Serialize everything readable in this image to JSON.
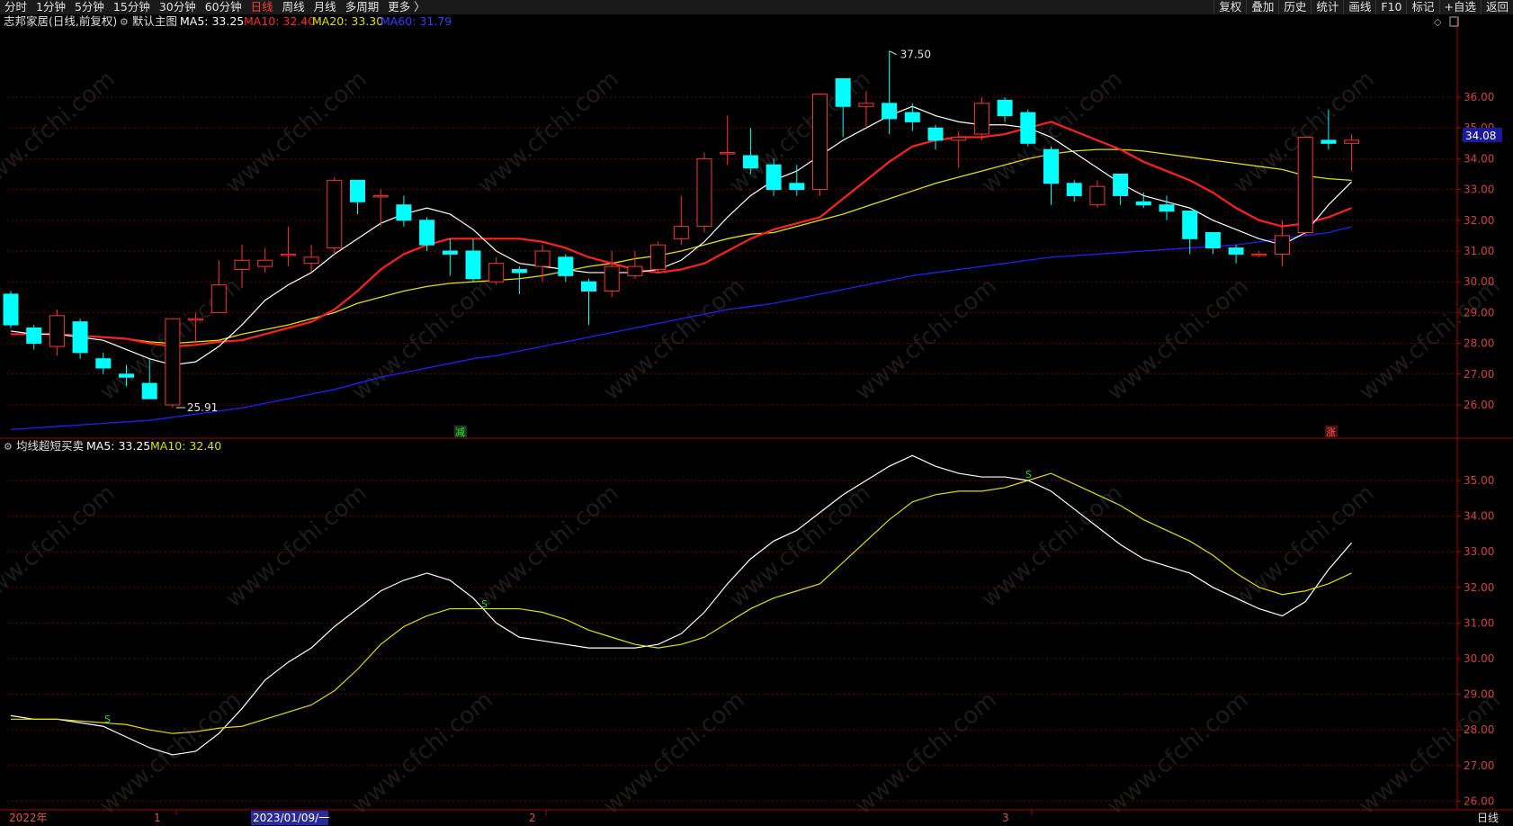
{
  "topbar": {
    "periods": [
      "分时",
      "1分钟",
      "5分钟",
      "15分钟",
      "30分钟",
      "60分钟",
      "日线",
      "周线",
      "月线",
      "多周期",
      "更多 〉"
    ],
    "active_period": "日线",
    "right_buttons": [
      "复权",
      "叠加",
      "历史",
      "统计",
      "画线",
      "F10",
      "标记",
      "+自选",
      "返回"
    ]
  },
  "main_header": {
    "stock": "志邦家居(日线,前复权)",
    "template": "默认主图",
    "ma5": "MA5: 33.25",
    "ma10": "MA10: 32.40",
    "ma20": "MA20: 33.30",
    "ma60": "MA60: 31.79"
  },
  "sub_header": {
    "name": "均线超短买卖",
    "ma5": "MA5: 33.25",
    "ma10": "MA10: 32.40"
  },
  "labels": {
    "high": "37.50",
    "low": "25.91",
    "current_price": "34.08",
    "sig_down": "减",
    "sig_up": "涨",
    "sub_signal": "S",
    "period_corner": "日线",
    "watermark": "www.cfchi.com"
  },
  "x_axis": {
    "labels": [
      "2022年",
      "1",
      "2023/01/09/一",
      "2",
      "3"
    ],
    "highlight": "2023/01/09/一"
  },
  "colors": {
    "up": "#ff3232",
    "down": "#00ffff",
    "ma5": "#ffffff",
    "ma10": "#ff2020",
    "ma20": "#e0e000",
    "ma60": "#2020ff",
    "grid": "#7a0000",
    "axis": "#b00000"
  },
  "chart_data": [
    {
      "type": "candlestick",
      "title": "志邦家居(日线,前复权)",
      "y_ticks": [
        26,
        27,
        28,
        29,
        30,
        31,
        32,
        33,
        34,
        35,
        36
      ],
      "candles": [
        {
          "o": 29.6,
          "c": 28.6,
          "h": 29.7,
          "l": 28.5
        },
        {
          "o": 28.5,
          "c": 28.0,
          "h": 28.6,
          "l": 27.8
        },
        {
          "o": 27.9,
          "c": 28.9,
          "h": 29.1,
          "l": 27.6
        },
        {
          "o": 28.7,
          "c": 27.7,
          "h": 28.8,
          "l": 27.5
        },
        {
          "o": 27.5,
          "c": 27.2,
          "h": 27.7,
          "l": 27.0
        },
        {
          "o": 27.0,
          "c": 26.9,
          "h": 27.3,
          "l": 26.6
        },
        {
          "o": 26.7,
          "c": 26.2,
          "h": 27.5,
          "l": 26.2
        },
        {
          "o": 26.0,
          "c": 28.8,
          "h": 28.8,
          "l": 25.91
        },
        {
          "o": 28.8,
          "c": 28.8,
          "h": 29.0,
          "l": 28.0
        },
        {
          "o": 29.0,
          "c": 29.9,
          "h": 30.7,
          "l": 29.0
        },
        {
          "o": 30.4,
          "c": 30.7,
          "h": 31.2,
          "l": 29.8
        },
        {
          "o": 30.5,
          "c": 30.7,
          "h": 31.1,
          "l": 30.3
        },
        {
          "o": 30.9,
          "c": 30.9,
          "h": 31.8,
          "l": 30.5
        },
        {
          "o": 30.6,
          "c": 30.8,
          "h": 31.2,
          "l": 30.3
        },
        {
          "o": 31.1,
          "c": 33.3,
          "h": 33.4,
          "l": 30.9
        },
        {
          "o": 33.3,
          "c": 32.6,
          "h": 33.3,
          "l": 32.2
        },
        {
          "o": 32.8,
          "c": 32.8,
          "h": 33.0,
          "l": 31.8
        },
        {
          "o": 32.5,
          "c": 32.0,
          "h": 32.8,
          "l": 31.8
        },
        {
          "o": 32.0,
          "c": 31.2,
          "h": 32.1,
          "l": 31.0
        },
        {
          "o": 31.0,
          "c": 30.9,
          "h": 31.4,
          "l": 30.2
        },
        {
          "o": 31.0,
          "c": 30.1,
          "h": 31.4,
          "l": 30.0
        },
        {
          "o": 30.0,
          "c": 30.6,
          "h": 30.8,
          "l": 29.9
        },
        {
          "o": 30.4,
          "c": 30.3,
          "h": 30.5,
          "l": 29.6
        },
        {
          "o": 30.5,
          "c": 31.0,
          "h": 31.2,
          "l": 30.0
        },
        {
          "o": 30.8,
          "c": 30.2,
          "h": 30.9,
          "l": 30.0
        },
        {
          "o": 30.0,
          "c": 29.7,
          "h": 30.1,
          "l": 28.6
        },
        {
          "o": 29.7,
          "c": 30.5,
          "h": 31.0,
          "l": 29.5
        },
        {
          "o": 30.2,
          "c": 30.5,
          "h": 31.0,
          "l": 30.1
        },
        {
          "o": 30.4,
          "c": 31.2,
          "h": 31.3,
          "l": 30.3
        },
        {
          "o": 31.4,
          "c": 31.8,
          "h": 32.8,
          "l": 31.2
        },
        {
          "o": 31.8,
          "c": 34.0,
          "h": 34.2,
          "l": 31.6
        },
        {
          "o": 34.2,
          "c": 34.2,
          "h": 35.4,
          "l": 33.8
        },
        {
          "o": 34.1,
          "c": 33.7,
          "h": 35.0,
          "l": 33.5
        },
        {
          "o": 33.8,
          "c": 33.0,
          "h": 34.0,
          "l": 32.8
        },
        {
          "o": 33.2,
          "c": 33.0,
          "h": 33.8,
          "l": 32.8
        },
        {
          "o": 33.0,
          "c": 36.1,
          "h": 36.1,
          "l": 32.8
        },
        {
          "o": 36.6,
          "c": 35.7,
          "h": 36.6,
          "l": 34.7
        },
        {
          "o": 35.7,
          "c": 35.8,
          "h": 36.2,
          "l": 35.0
        },
        {
          "o": 35.8,
          "c": 35.3,
          "h": 37.5,
          "l": 34.8
        },
        {
          "o": 35.5,
          "c": 35.2,
          "h": 35.8,
          "l": 34.9
        },
        {
          "o": 35.0,
          "c": 34.6,
          "h": 35.1,
          "l": 34.3
        },
        {
          "o": 34.6,
          "c": 34.7,
          "h": 34.9,
          "l": 33.7
        },
        {
          "o": 34.8,
          "c": 35.8,
          "h": 36.0,
          "l": 34.6
        },
        {
          "o": 35.9,
          "c": 35.4,
          "h": 36.0,
          "l": 35.2
        },
        {
          "o": 35.5,
          "c": 34.5,
          "h": 35.6,
          "l": 34.4
        },
        {
          "o": 34.3,
          "c": 33.2,
          "h": 34.4,
          "l": 32.5
        },
        {
          "o": 33.2,
          "c": 32.8,
          "h": 33.3,
          "l": 32.6
        },
        {
          "o": 32.5,
          "c": 33.1,
          "h": 33.3,
          "l": 32.4
        },
        {
          "o": 33.5,
          "c": 32.8,
          "h": 33.5,
          "l": 32.5
        },
        {
          "o": 32.6,
          "c": 32.5,
          "h": 32.9,
          "l": 32.4
        },
        {
          "o": 32.5,
          "c": 32.3,
          "h": 32.8,
          "l": 32.0
        },
        {
          "o": 32.3,
          "c": 31.4,
          "h": 32.3,
          "l": 30.9
        },
        {
          "o": 31.6,
          "c": 31.1,
          "h": 31.6,
          "l": 30.9
        },
        {
          "o": 31.1,
          "c": 30.9,
          "h": 31.2,
          "l": 30.6
        },
        {
          "o": 30.9,
          "c": 30.9,
          "h": 31.0,
          "l": 30.8
        },
        {
          "o": 30.9,
          "c": 31.5,
          "h": 32.0,
          "l": 30.5
        },
        {
          "o": 31.6,
          "c": 34.7,
          "h": 34.7,
          "l": 31.5
        },
        {
          "o": 34.6,
          "c": 34.5,
          "h": 35.6,
          "l": 34.3
        },
        {
          "o": 34.5,
          "c": 34.6,
          "h": 34.8,
          "l": 33.6
        }
      ],
      "series": [
        {
          "name": "MA5",
          "values": [
            28.4,
            28.3,
            28.3,
            28.2,
            28.1,
            27.8,
            27.5,
            27.3,
            27.4,
            27.9,
            28.6,
            29.4,
            29.9,
            30.3,
            30.9,
            31.4,
            31.9,
            32.2,
            32.4,
            32.2,
            31.7,
            31.0,
            30.6,
            30.5,
            30.4,
            30.3,
            30.3,
            30.3,
            30.4,
            30.7,
            31.3,
            32.1,
            32.8,
            33.3,
            33.6,
            34.1,
            34.6,
            35.0,
            35.4,
            35.7,
            35.4,
            35.2,
            35.1,
            35.1,
            35.0,
            34.7,
            34.2,
            33.7,
            33.2,
            32.8,
            32.6,
            32.4,
            32.0,
            31.7,
            31.4,
            31.2,
            31.6,
            32.5,
            33.25
          ]
        },
        {
          "name": "MA10",
          "values": [
            28.3,
            28.3,
            28.3,
            28.25,
            28.2,
            28.15,
            28.0,
            27.9,
            27.95,
            28.05,
            28.1,
            28.3,
            28.5,
            28.7,
            29.1,
            29.7,
            30.4,
            30.9,
            31.2,
            31.4,
            31.4,
            31.4,
            31.4,
            31.3,
            31.1,
            30.8,
            30.6,
            30.4,
            30.3,
            30.4,
            30.6,
            31.0,
            31.4,
            31.7,
            31.9,
            32.1,
            32.7,
            33.3,
            33.9,
            34.4,
            34.6,
            34.7,
            34.7,
            34.8,
            35.0,
            35.2,
            34.9,
            34.6,
            34.3,
            33.9,
            33.6,
            33.3,
            32.9,
            32.4,
            32.0,
            31.8,
            31.9,
            32.1,
            32.4
          ]
        },
        {
          "name": "MA20",
          "values": [
            28.3,
            28.3,
            28.3,
            28.25,
            28.2,
            28.15,
            28.05,
            28.0,
            28.05,
            28.1,
            28.3,
            28.45,
            28.6,
            28.8,
            29.0,
            29.3,
            29.5,
            29.7,
            29.85,
            29.95,
            30.0,
            30.05,
            30.1,
            30.2,
            30.35,
            30.5,
            30.6,
            30.75,
            30.85,
            31.0,
            31.2,
            31.4,
            31.55,
            31.6,
            31.8,
            32.0,
            32.2,
            32.45,
            32.7,
            32.95,
            33.2,
            33.4,
            33.6,
            33.8,
            34.0,
            34.15,
            34.25,
            34.3,
            34.3,
            34.25,
            34.15,
            34.05,
            33.95,
            33.85,
            33.75,
            33.65,
            33.45,
            33.35,
            33.3
          ]
        },
        {
          "name": "MA60",
          "values": [
            25.2,
            25.25,
            25.3,
            25.35,
            25.4,
            25.45,
            25.5,
            25.6,
            25.7,
            25.8,
            25.9,
            26.05,
            26.2,
            26.35,
            26.5,
            26.7,
            26.9,
            27.05,
            27.2,
            27.35,
            27.5,
            27.6,
            27.75,
            27.9,
            28.05,
            28.2,
            28.35,
            28.5,
            28.65,
            28.8,
            28.95,
            29.1,
            29.2,
            29.3,
            29.45,
            29.6,
            29.75,
            29.9,
            30.05,
            30.2,
            30.3,
            30.4,
            30.5,
            30.6,
            30.7,
            30.8,
            30.85,
            30.9,
            30.95,
            31.0,
            31.05,
            31.1,
            31.15,
            31.2,
            31.3,
            31.4,
            31.5,
            31.6,
            31.79
          ]
        }
      ]
    },
    {
      "type": "line",
      "title": "均线超短买卖",
      "y_ticks": [
        26,
        27,
        28,
        29,
        30,
        31,
        32,
        33,
        34,
        35
      ],
      "series_ref": [
        "MA5",
        "MA10"
      ]
    }
  ]
}
